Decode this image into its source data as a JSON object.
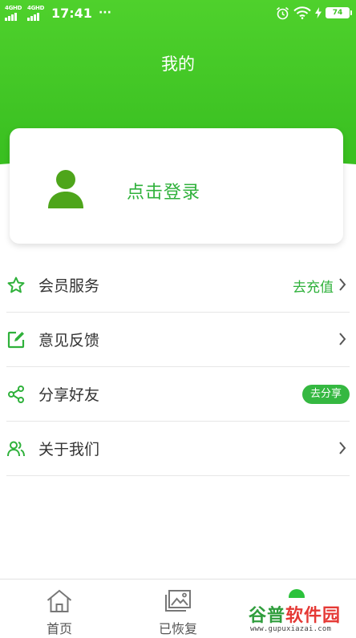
{
  "status_bar": {
    "network_1": "4G",
    "network_1_sub": "HD",
    "network_2": "4G",
    "network_2_sub": "HD",
    "time": "17:41",
    "more": "···",
    "battery": "74"
  },
  "header": {
    "title": "我的"
  },
  "login": {
    "prompt": "点击登录"
  },
  "menu": {
    "items": [
      {
        "label": "会员服务",
        "action": "去充值",
        "icon": "star-icon"
      },
      {
        "label": "意见反馈",
        "icon": "edit-icon"
      },
      {
        "label": "分享好友",
        "action": "去分享",
        "icon": "share-icon"
      },
      {
        "label": "关于我们",
        "icon": "users-icon"
      }
    ]
  },
  "bottom_nav": {
    "items": [
      {
        "label": "首页",
        "icon": "home-icon"
      },
      {
        "label": "已恢复",
        "icon": "image-icon"
      },
      {
        "label": "",
        "icon": "profile-dot-icon",
        "active": true
      }
    ]
  },
  "watermark": {
    "brand_part1": "谷普",
    "brand_part2": "软件园",
    "url": "www.gupuxiazai.com"
  },
  "colors": {
    "header_green": "#3fc424",
    "accent_green": "#2fb13b",
    "avatar_green": "#4ea51b"
  }
}
